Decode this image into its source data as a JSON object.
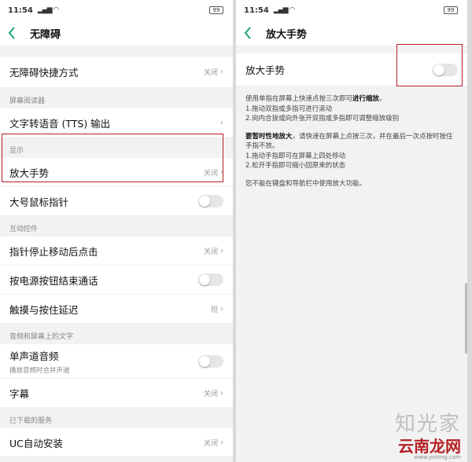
{
  "left": {
    "status": {
      "time": "11:54",
      "signal": "@@l ≡",
      "battery": "99"
    },
    "title": "无障碍",
    "rows": {
      "shortcut": {
        "label": "无障碍快捷方式",
        "value": "关闭"
      },
      "section_reader": "屏幕阅读器",
      "tts": {
        "label": "文字转语音 (TTS) 输出"
      },
      "section_display": "显示",
      "magnify": {
        "label": "放大手势",
        "value": "关闭"
      },
      "big_pointer": {
        "label": "大号鼠标指针"
      },
      "section_interact": "互动控件",
      "dwell_click": {
        "label": "指针停止移动后点击",
        "value": "关闭"
      },
      "power_end_call": {
        "label": "按电源按钮结束通话"
      },
      "touch_delay": {
        "label": "触摸与按住延迟",
        "value": "短"
      },
      "section_audio": "音频和屏幕上的文字",
      "mono_audio": {
        "label": "单声道音频",
        "sub": "播放音频时合并声道"
      },
      "captions": {
        "label": "字幕",
        "value": "关闭"
      },
      "section_downloaded": "已下载的服务",
      "uc_install": {
        "label": "UC自动安装",
        "value": "关闭"
      }
    }
  },
  "right": {
    "status": {
      "time": "11:54",
      "battery": "99"
    },
    "title": "放大手势",
    "toggle_label": "放大手势",
    "info": {
      "p1_pre": "使用单指在屏幕上快速点按三次即可",
      "p1_bold": "进行缩放",
      "p1_post": "。",
      "p1_l1": "1.拖动双指或多指可进行滚动",
      "p1_l2": "2.向内合拢或向外张开双指或多指即可调整缩放级别",
      "p2_bold": "要暂时性地放大",
      "p2_text": "，请快速在屏幕上点按三次，并在最后一次点按时按住手指不放。",
      "p2_l1": "1.拖动手指即可在屏幕上四处移动",
      "p2_l2": "2.松开手指即可缩小回原来的状态",
      "p3": "您不能在键盘和导航栏中使用放大功能。"
    },
    "watermark": {
      "line1": "知光家",
      "line2": "云南龙网",
      "line3": "www.ynlong.com"
    }
  }
}
